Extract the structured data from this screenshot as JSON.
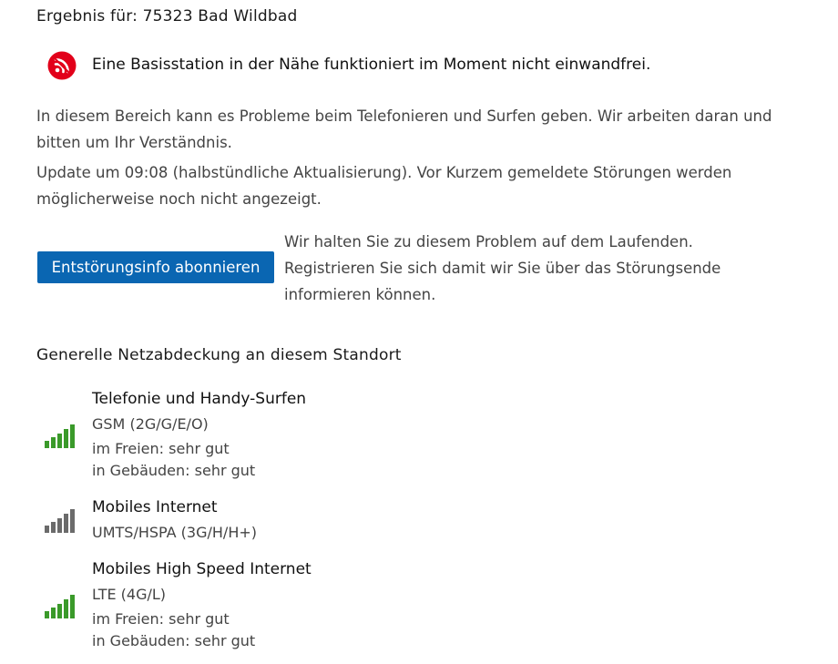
{
  "header": {
    "result_prefix": "Ergebnis für:",
    "location": "75323 Bad Wildbad"
  },
  "alert": {
    "icon": "signal-disruption-icon",
    "icon_color": "#e2001a",
    "message": "Eine Basisstation in der Nähe funktioniert im Moment nicht einwandfrei."
  },
  "info": {
    "paragraph1": "In diesem Bereich kann es Probleme beim Telefonieren und Surfen geben. Wir arbeiten daran und bitten um Ihr Verständnis.",
    "paragraph2": "Update um 09:08 (halbstündliche Aktualisierung). Vor Kurzem gemeldete Störungen werden möglicherweise noch nicht angezeigt."
  },
  "subscribe": {
    "button_label": "Entstörungsinfo abonnieren",
    "button_color": "#0a66b2",
    "description": "Wir halten Sie zu diesem Problem auf dem Laufenden. Registrieren Sie sich damit wir Sie über das Störungsende informieren können."
  },
  "coverage": {
    "title": "Generelle Netzabdeckung an diesem Standort",
    "items": [
      {
        "name": "Telefonie und Handy-Surfen",
        "technology": "GSM (2G/G/E/O)",
        "outdoor": "im Freien: sehr gut",
        "indoor": "in Gebäuden: sehr gut",
        "signal_bars": 5,
        "signal_color": "#3a9a2a"
      },
      {
        "name": "Mobiles Internet",
        "technology": "UMTS/HSPA (3G/H/H+)",
        "signal_bars": 0,
        "signal_color": "#6b6b6b"
      },
      {
        "name": "Mobiles High Speed Internet",
        "technology": "LTE (4G/L)",
        "outdoor": "im Freien: sehr gut",
        "indoor": "in Gebäuden: sehr gut",
        "signal_bars": 5,
        "signal_color": "#3a9a2a"
      }
    ]
  }
}
